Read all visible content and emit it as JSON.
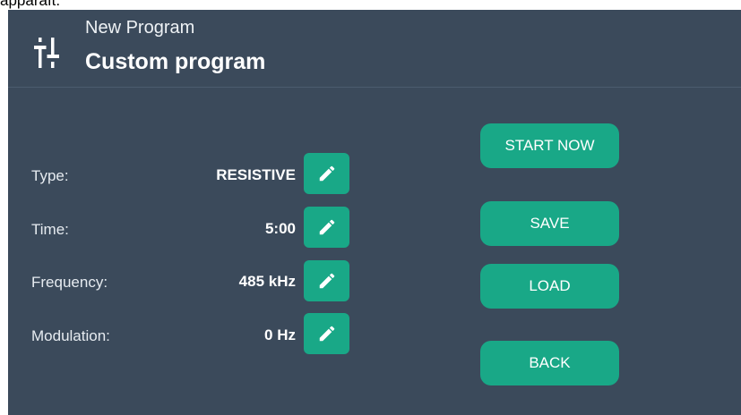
{
  "cutoff_text": "apparaît.",
  "header": {
    "icon": "sliders-icon",
    "subtitle": "New Program",
    "title": "Custom program"
  },
  "settings": [
    {
      "label": "Type:",
      "value": "RESISTIVE",
      "edit_icon": "pencil-icon"
    },
    {
      "label": "Time:",
      "value": "5:00",
      "edit_icon": "pencil-icon"
    },
    {
      "label": "Frequency:",
      "value": "485 kHz",
      "edit_icon": "pencil-icon"
    },
    {
      "label": "Modulation:",
      "value": "0 Hz",
      "edit_icon": "pencil-icon"
    }
  ],
  "actions": {
    "start_now": "START NOW",
    "save": "SAVE",
    "load": "LOAD",
    "back": "BACK"
  },
  "colors": {
    "background": "#3b4a5b",
    "accent": "#19a887",
    "text": "#ffffff"
  }
}
